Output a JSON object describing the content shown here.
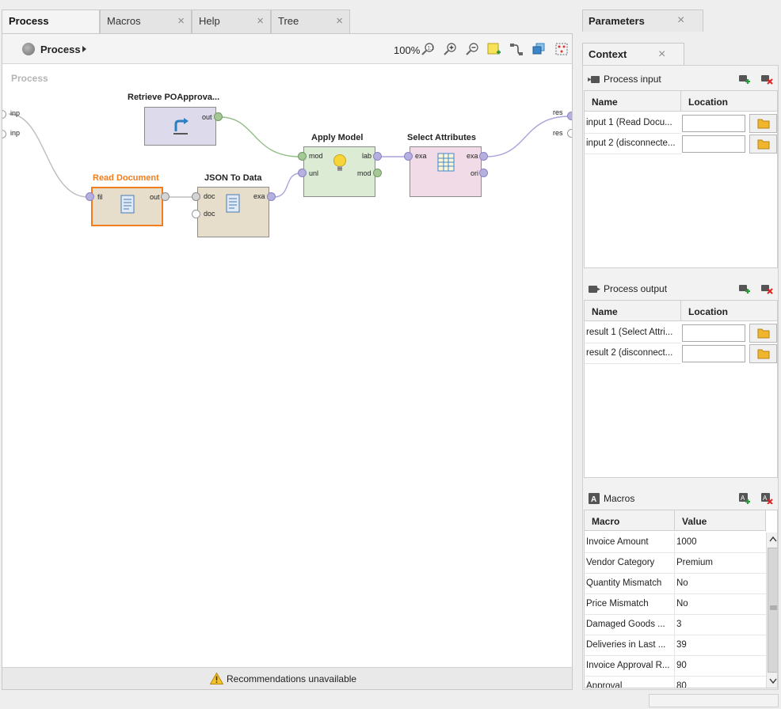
{
  "left_tabs": [
    {
      "label": "Process",
      "active": true
    },
    {
      "label": "Macros",
      "active": false
    },
    {
      "label": "Help",
      "active": false
    },
    {
      "label": "Tree",
      "active": false
    }
  ],
  "close_glyph": "×",
  "process": {
    "breadcrumb": "Process",
    "zoom": "100%",
    "canvas_title": "Process",
    "toolbar_icons": [
      "zoom-fit-icon",
      "zoom-in-icon",
      "zoom-out-icon",
      "add-note-icon",
      "auto-wire-icon",
      "layers-icon",
      "arrange-icon"
    ],
    "left_ports": [
      "inp",
      "inp"
    ],
    "right_ports": [
      "res",
      "res"
    ],
    "operators": {
      "retrieve": {
        "title": "Retrieve POApprova...",
        "ports_out": [
          "out"
        ]
      },
      "read_document": {
        "title": "Read Document",
        "ports_in": [
          "fil"
        ],
        "ports_out": [
          "out"
        ]
      },
      "json_to_data": {
        "title": "JSON To Data",
        "ports_in": [
          "doc",
          "doc"
        ],
        "ports_out": [
          "exa"
        ]
      },
      "apply_model": {
        "title": "Apply Model",
        "ports_in": [
          "mod",
          "unl"
        ],
        "ports_out": [
          "lab",
          "mod"
        ]
      },
      "select_attributes": {
        "title": "Select Attributes",
        "ports_in": [
          "exa"
        ],
        "ports_out": [
          "exa",
          "ori"
        ]
      }
    },
    "status": "Recommendations unavailable"
  },
  "right_tabs": {
    "parameters": "Parameters",
    "context": "Context"
  },
  "process_input": {
    "title": "Process input",
    "col_name": "Name",
    "col_location": "Location",
    "rows": [
      "input 1 (Read Docu...",
      "input 2 (disconnecte..."
    ]
  },
  "process_output": {
    "title": "Process output",
    "col_name": "Name",
    "col_location": "Location",
    "rows": [
      "result 1 (Select Attri...",
      "result 2 (disconnect..."
    ]
  },
  "macros": {
    "title": "Macros",
    "col_macro": "Macro",
    "col_value": "Value",
    "rows": [
      {
        "macro": "Invoice Amount",
        "value": "1000"
      },
      {
        "macro": "Vendor Category",
        "value": "Premium"
      },
      {
        "macro": "Quantity Mismatch",
        "value": "No"
      },
      {
        "macro": "Price Mismatch",
        "value": "No"
      },
      {
        "macro": "Damaged Goods ...",
        "value": "3"
      },
      {
        "macro": "Deliveries in Last ...",
        "value": "39"
      },
      {
        "macro": "Invoice Approval R...",
        "value": "90"
      },
      {
        "macro": "Approval",
        "value": "80"
      }
    ]
  },
  "colors": {
    "retrieve_fill": "#dcdaeb",
    "read_doc_fill": "#e6ddcb",
    "read_doc_accent": "#f07d1e",
    "json_fill": "#e6ddcb",
    "apply_fill": "#dcecd4",
    "select_fill": "#f1dbe7",
    "port_model": "#a5c896",
    "port_data": "#b5b0de",
    "port_file": "#d4d4d4"
  }
}
